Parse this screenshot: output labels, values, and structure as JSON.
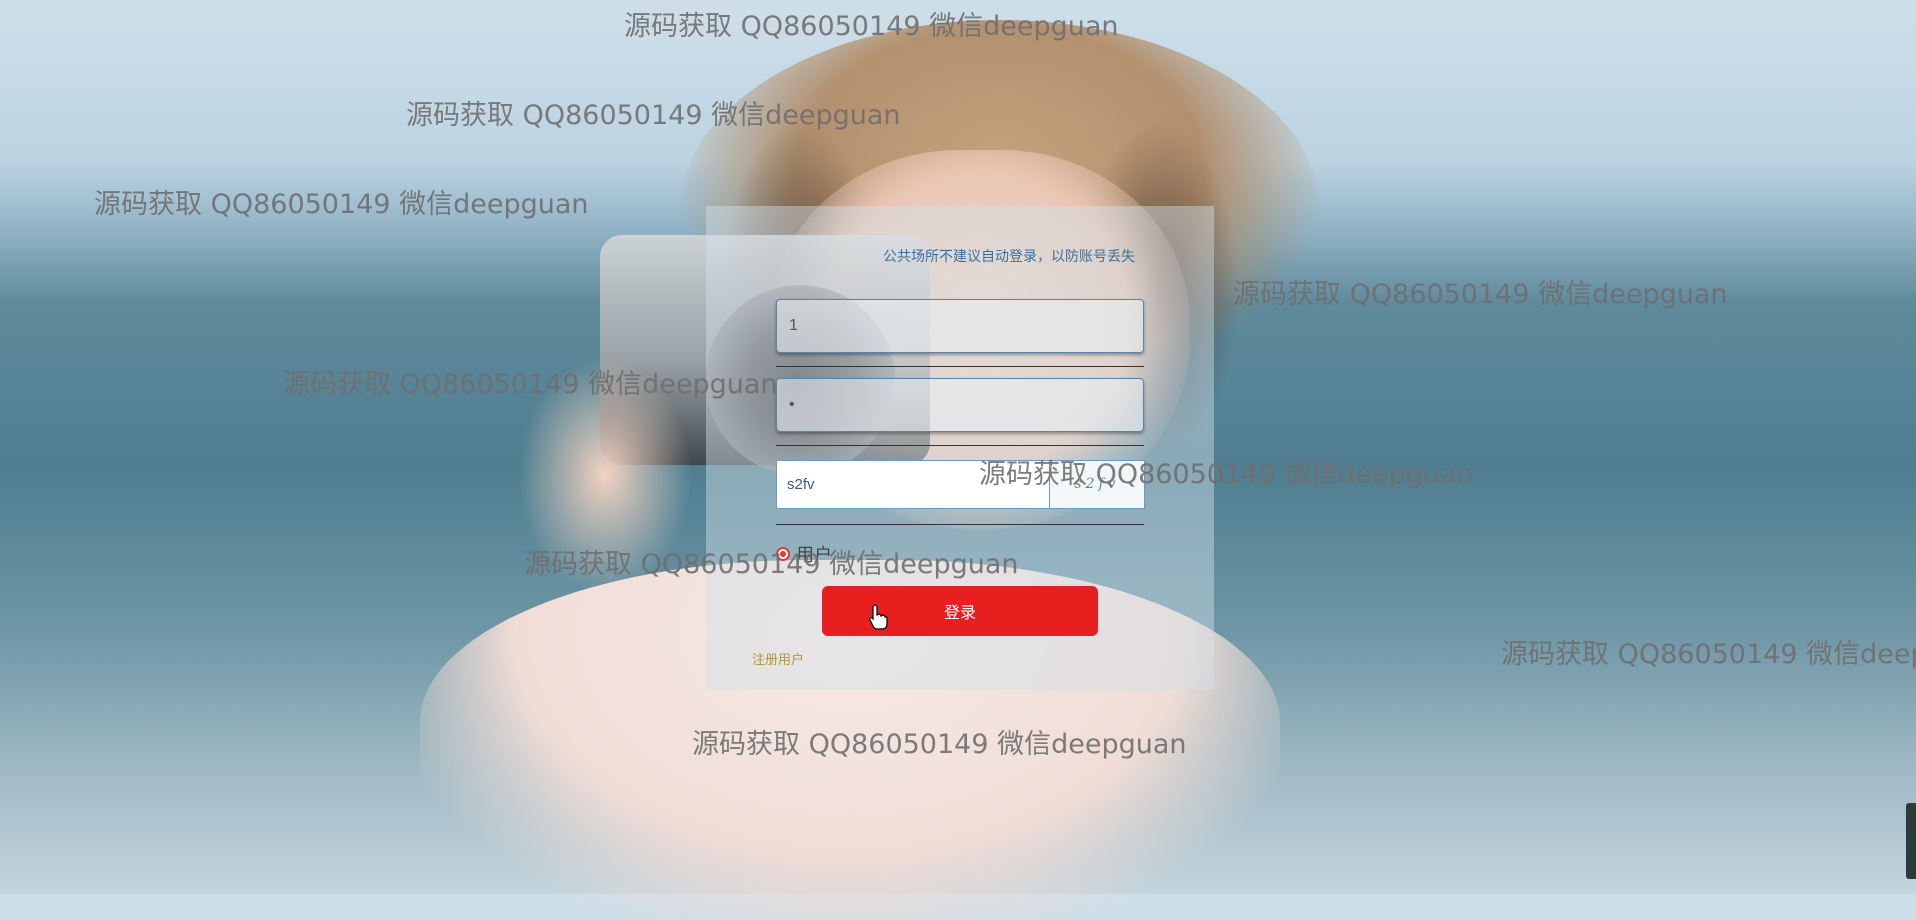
{
  "watermark_text": "源码获取 QQ86050149 微信deepguan",
  "login": {
    "tip": "公共场所不建议自动登录，以防账号丢失",
    "username_value": "1",
    "password_value": "•",
    "captcha_value": "s2fv",
    "captcha_image_text": "s2fv",
    "role_label": "用户",
    "login_button": "登录",
    "register_link": "注册用户"
  },
  "colors": {
    "accent_red": "#e81f1f",
    "tip_blue": "#3a6f9c",
    "register_gold": "#b9923f"
  }
}
